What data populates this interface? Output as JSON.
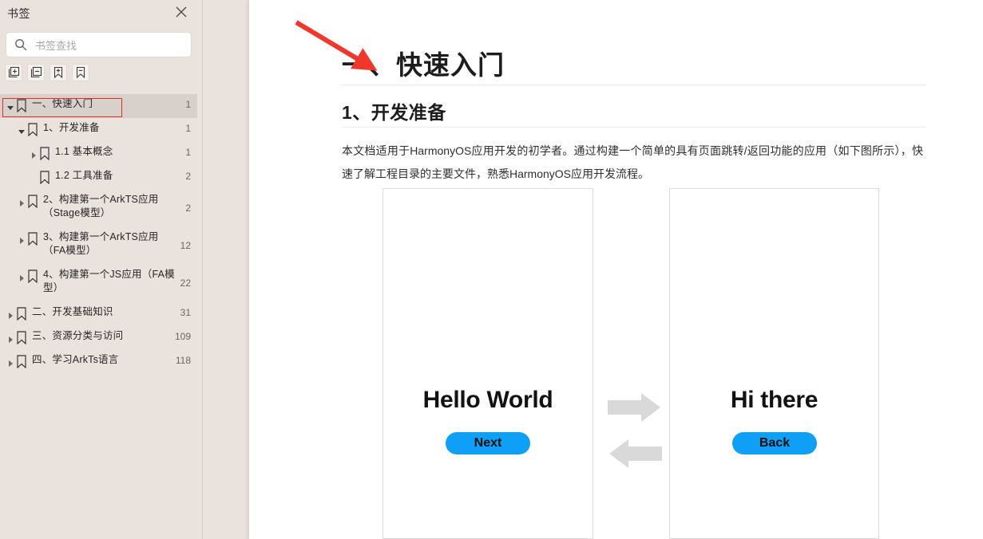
{
  "panel": {
    "title": "书签",
    "close_icon": "close-icon",
    "search": {
      "placeholder": "书签查找",
      "value": "",
      "icon": "search-icon"
    },
    "toolbar": [
      {
        "name": "expand-all-button",
        "icon": "box-plus-icon"
      },
      {
        "name": "collapse-all-button",
        "icon": "box-minus-icon"
      },
      {
        "name": "add-bookmark-button",
        "icon": "bookmark-plus-icon"
      },
      {
        "name": "remove-bookmark-button",
        "icon": "bookmark-minus-icon"
      }
    ],
    "tree": [
      {
        "label": "一、快速入门",
        "page": "1",
        "level": 0,
        "twisty": "down",
        "selected": true,
        "outlined": true,
        "lines": 1
      },
      {
        "label": "1、开发准备",
        "page": "1",
        "level": 1,
        "twisty": "down",
        "selected": false,
        "outlined": false,
        "lines": 1
      },
      {
        "label": "1.1 基本概念",
        "page": "1",
        "level": 2,
        "twisty": "right",
        "selected": false,
        "outlined": false,
        "lines": 1
      },
      {
        "label": "1.2 工具准备",
        "page": "2",
        "level": 2,
        "twisty": "none",
        "selected": false,
        "outlined": false,
        "lines": 1
      },
      {
        "label": "2、构建第一个ArkTS应用（Stage模型）",
        "page": "2",
        "level": 1,
        "twisty": "right",
        "selected": false,
        "outlined": false,
        "lines": 2
      },
      {
        "label": "3、构建第一个ArkTS应用（FA模型）",
        "page": "12",
        "level": 1,
        "twisty": "right",
        "selected": false,
        "outlined": false,
        "lines": 2
      },
      {
        "label": "4、构建第一个JS应用（FA模型）",
        "page": "22",
        "level": 1,
        "twisty": "right",
        "selected": false,
        "outlined": false,
        "lines": 2
      },
      {
        "label": "二、开发基础知识",
        "page": "31",
        "level": 0,
        "twisty": "right",
        "selected": false,
        "outlined": false,
        "lines": 1
      },
      {
        "label": "三、资源分类与访问",
        "page": "109",
        "level": 0,
        "twisty": "right",
        "selected": false,
        "outlined": false,
        "lines": 1
      },
      {
        "label": "四、学习ArkTs语言",
        "page": "118",
        "level": 0,
        "twisty": "right",
        "selected": false,
        "outlined": false,
        "lines": 1
      }
    ]
  },
  "document": {
    "heading1": "一、快速入门",
    "heading2": "1、开发准备",
    "paragraph": "本文档适用于HarmonyOS应用开发的初学者。通过构建一个简单的具有页面跳转/返回功能的应用（如下图所示），快速了解工程目录的主要文件，熟悉HarmonyOS应用开发流程。",
    "figure": {
      "left_screen": {
        "text": "Hello World",
        "button": "Next"
      },
      "right_screen": {
        "text": "Hi there",
        "button": "Back"
      },
      "arrow_forward_icon": "arrow-right-icon",
      "arrow_back_icon": "arrow-left-icon"
    }
  },
  "annotation": {
    "arrow_icon": "red-arrow-annotation",
    "arrow_color": "#f0372b",
    "outline_color": "#ee2b22"
  },
  "colors": {
    "panel_background": "#eae2dd",
    "selected_row": "#d8d0cb",
    "page_background": "#ffffff",
    "button_blue": "#0fa0f5",
    "figure_arrow_gray": "#d9d9d9"
  }
}
